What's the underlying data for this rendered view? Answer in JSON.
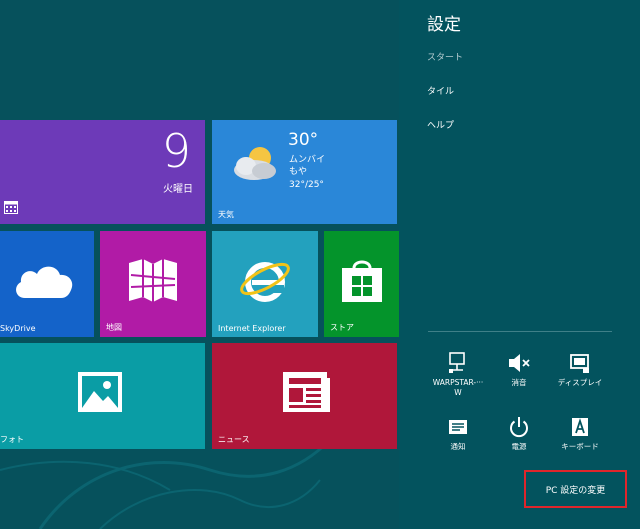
{
  "start": {
    "tiles": {
      "calendar": {
        "day": "9",
        "weekday": "火曜日"
      },
      "weather": {
        "temp": "30°",
        "location": "ムンバイ",
        "condition": "もや",
        "range": "32°/25°",
        "label": "天気"
      },
      "skydrive": {
        "label": "SkyDrive"
      },
      "maps": {
        "label": "地図"
      },
      "ie": {
        "label": "Internet Explorer"
      },
      "store": {
        "label": "ストア"
      },
      "photos": {
        "label": "フォト"
      },
      "news": {
        "label": "ニュース"
      }
    },
    "colors": {
      "background": "#06515c",
      "calendar": "#6d3ab8",
      "weather": "#2a87d8",
      "skydrive": "#1463c9",
      "maps": "#b11ba6",
      "ie": "#23a1be",
      "store": "#04942b",
      "photos": "#0a9da5",
      "news": "#b0173a"
    }
  },
  "charm": {
    "title": "設定",
    "subtitle": "スタート",
    "items": [
      "タイル",
      "ヘルプ"
    ],
    "quick": {
      "network": "WARPSTAR-···\nW",
      "sound": "消音",
      "display": "ディスプレイ",
      "notifications": "通知",
      "power": "電源",
      "keyboard": "キーボード"
    },
    "pc_settings": "PC 設定の変更",
    "colors": {
      "panel": "#03535e",
      "highlight_border": "#e0252b"
    }
  }
}
